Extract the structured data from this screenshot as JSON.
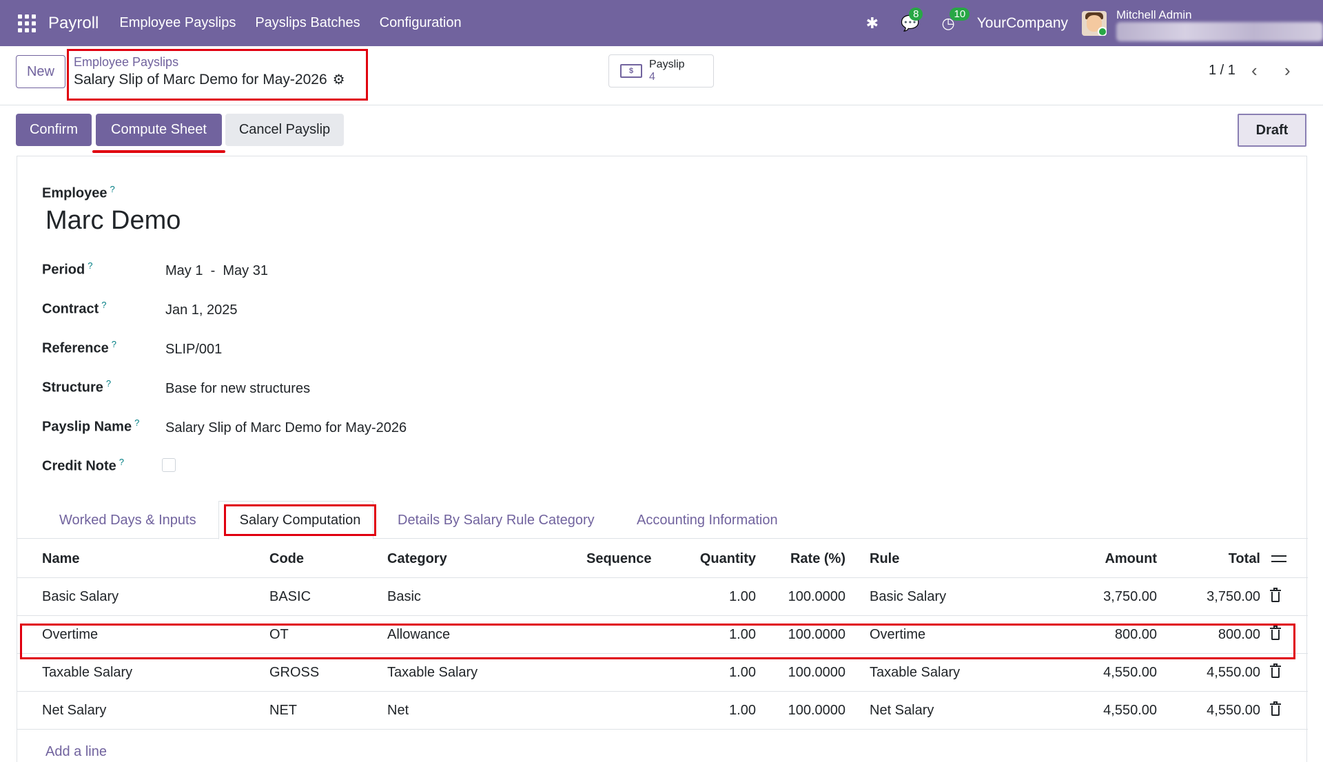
{
  "app": {
    "name": "Payroll",
    "menu": [
      "Employee Payslips",
      "Payslips Batches",
      "Configuration"
    ],
    "messages_count": "8",
    "activities_count": "10",
    "company": "YourCompany",
    "user": "Mitchell Admin"
  },
  "control_panel": {
    "new_label": "New",
    "breadcrumb_parent": "Employee Payslips",
    "breadcrumb_current": "Salary Slip of Marc Demo for May-2026",
    "smart_button_label": "Payslip",
    "smart_button_count": "4",
    "pager": "1 / 1"
  },
  "status": {
    "confirm": "Confirm",
    "compute": "Compute Sheet",
    "cancel": "Cancel Payslip",
    "state": "Draft"
  },
  "form": {
    "employee_label": "Employee",
    "employee": "Marc Demo",
    "period_label": "Period",
    "period_from": "May 1",
    "period_sep": "-",
    "period_to": "May 31",
    "contract_label": "Contract",
    "contract": "Jan 1, 2025",
    "reference_label": "Reference",
    "reference": "SLIP/001",
    "structure_label": "Structure",
    "structure": "Base for new structures",
    "payslip_name_label": "Payslip Name",
    "payslip_name": "Salary Slip of Marc Demo for May-2026",
    "credit_note_label": "Credit Note",
    "help": "?"
  },
  "tabs": [
    "Worked Days & Inputs",
    "Salary Computation",
    "Details By Salary Rule Category",
    "Accounting Information"
  ],
  "table": {
    "headers": [
      "Name",
      "Code",
      "Category",
      "Sequence",
      "Quantity",
      "Rate (%)",
      "Rule",
      "Amount",
      "Total"
    ],
    "rows": [
      {
        "name": "Basic Salary",
        "code": "BASIC",
        "category": "Basic",
        "quantity": "1.00",
        "rate": "100.0000",
        "rule": "Basic Salary",
        "amount": "3,750.00",
        "total": "3,750.00"
      },
      {
        "name": "Overtime",
        "code": "OT",
        "category": "Allowance",
        "quantity": "1.00",
        "rate": "100.0000",
        "rule": "Overtime",
        "amount": "800.00",
        "total": "800.00"
      },
      {
        "name": "Taxable Salary",
        "code": "GROSS",
        "category": "Taxable Salary",
        "quantity": "1.00",
        "rate": "100.0000",
        "rule": "Taxable Salary",
        "amount": "4,550.00",
        "total": "4,550.00"
      },
      {
        "name": "Net Salary",
        "code": "NET",
        "category": "Net",
        "quantity": "1.00",
        "rate": "100.0000",
        "rule": "Net Salary",
        "amount": "4,550.00",
        "total": "4,550.00"
      }
    ],
    "add_line": "Add a line"
  },
  "colors": {
    "brand": "#71639e",
    "highlight": "#e0000f",
    "badge": "#28a745"
  }
}
